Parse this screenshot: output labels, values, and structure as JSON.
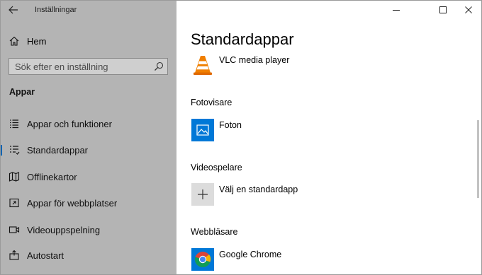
{
  "window": {
    "title": "Inställningar",
    "controls": {
      "minimize": "minimize",
      "maximize": "maximize",
      "close": "close"
    }
  },
  "sidebar": {
    "home_label": "Hem",
    "search_placeholder": "Sök efter en inställning",
    "section_title": "Appar",
    "items": [
      {
        "label": "Appar och funktioner",
        "icon": "list-icon"
      },
      {
        "label": "Standardappar",
        "icon": "default-apps-icon",
        "selected": true
      },
      {
        "label": "Offlinekartor",
        "icon": "map-icon"
      },
      {
        "label": "Appar för webbplatser",
        "icon": "open-external-icon"
      },
      {
        "label": "Videouppspelning",
        "icon": "video-icon"
      },
      {
        "label": "Autostart",
        "icon": "startup-icon"
      }
    ]
  },
  "main": {
    "title": "Standardappar",
    "music_app": {
      "name": "VLC media player",
      "icon": "vlc-cone-icon"
    },
    "photo": {
      "category": "Fotovisare",
      "app": "Foton",
      "icon": "photos-icon"
    },
    "video": {
      "category": "Videospelare",
      "app": "Välj en standardapp",
      "icon": "plus-icon"
    },
    "browser": {
      "category": "Webbläsare",
      "app": "Google Chrome",
      "icon": "chrome-icon"
    }
  },
  "colors": {
    "sidebar_bg": "#b4b4b4",
    "accent": "#0063b1",
    "photos_tile": "#0078d7",
    "vlc_orange": "#f07f00"
  }
}
